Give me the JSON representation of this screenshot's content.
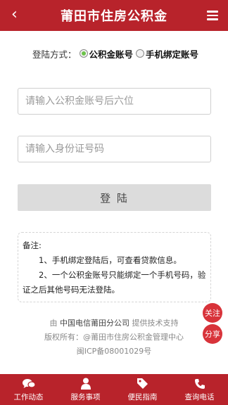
{
  "header": {
    "title": "莆田市住房公积金",
    "back_icon": "‹"
  },
  "login": {
    "type_label": "登陆方式：",
    "options": [
      {
        "label": "公积金账号",
        "selected": true
      },
      {
        "label": "手机绑定账号",
        "selected": false
      }
    ],
    "account_placeholder": "请输入公积金账号后六位",
    "id_placeholder": "请输入身份证号码",
    "submit_label": "登 陆"
  },
  "note": {
    "title": "备注:",
    "line1": "1、手机绑定登陆后，可查看贷款信息。",
    "line2": "2、一个公积金账号只能绑定一个手机号码，验证之后其他号码无法登陆。"
  },
  "footer": {
    "prefix": "由",
    "provider": "中国电信莆田分公司",
    "suffix": "提供技术支持",
    "copyright": "版权所有：@莆田市住房公积金管理中心",
    "icp": "闽ICP备08001029号"
  },
  "floating": {
    "follow": "关注",
    "share": "分享"
  },
  "tabs": [
    {
      "label": "工作动态",
      "icon": "chat-icon"
    },
    {
      "label": "服务事项",
      "icon": "person-icon"
    },
    {
      "label": "便民指南",
      "icon": "tag-icon"
    },
    {
      "label": "查询电话",
      "icon": "phone-icon"
    }
  ],
  "colors": {
    "brand": "#b8232b",
    "radio_selected": "#6cc24a"
  }
}
